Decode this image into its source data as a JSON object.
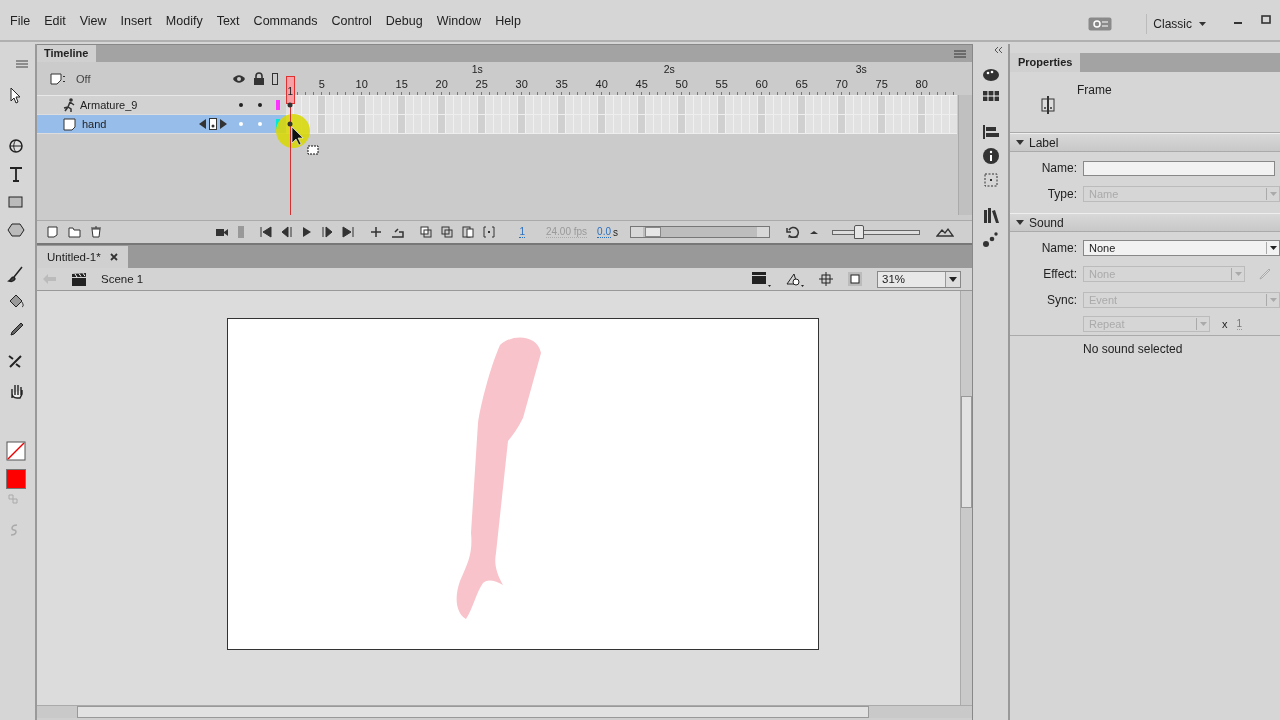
{
  "menu": [
    "File",
    "Edit",
    "View",
    "Insert",
    "Modify",
    "Text",
    "Commands",
    "Control",
    "Debug",
    "Window",
    "Help"
  ],
  "workspace": "Classic",
  "tools": {
    "fill_swatch": {
      "color": "#ff0000"
    }
  },
  "timeline": {
    "title": "Timeline",
    "onion": "Off",
    "seconds": [
      "1s",
      "2s",
      "3s"
    ],
    "ruler": [
      "5",
      "10",
      "15",
      "20",
      "25",
      "30",
      "35",
      "40",
      "45",
      "50",
      "55",
      "60",
      "65",
      "70",
      "75",
      "80"
    ],
    "playhead_frame": "1",
    "layers": [
      {
        "name": "Armature_9",
        "kind": "armature",
        "selected": false,
        "color": "#ff33ff"
      },
      {
        "name": "hand",
        "kind": "layer",
        "selected": true,
        "color": "#00e8d8"
      }
    ],
    "current_frame": "1",
    "fps": "24.00 fps",
    "elapsed": "0.0",
    "elapsed_unit": "s",
    "frame_zoom": {
      "level": 0.27
    }
  },
  "document": {
    "tab": "Untitled-1*",
    "scene": "Scene 1",
    "zoom": "31%"
  },
  "properties": {
    "title": "Properties",
    "object": "Frame",
    "sections": [
      {
        "title": "Label",
        "expanded": true,
        "rows": [
          {
            "kind": "text",
            "label": "Name:",
            "disabled": false
          },
          {
            "kind": "select",
            "label": "Type:",
            "value": "Name",
            "disabled": true
          }
        ]
      },
      {
        "title": "Sound",
        "expanded": true,
        "rows": [
          {
            "kind": "select",
            "label": "Name:",
            "value": "None",
            "disabled": false
          },
          {
            "kind": "effect",
            "label": "Effect:",
            "value": "None",
            "disabled": true
          },
          {
            "kind": "select",
            "label": "Sync:",
            "value": "Event",
            "disabled": true
          },
          {
            "kind": "repeat",
            "value": "Repeat",
            "disabled": true,
            "times": "x",
            "count": "1"
          },
          {
            "kind": "note",
            "text": "No sound selected"
          }
        ]
      }
    ]
  }
}
